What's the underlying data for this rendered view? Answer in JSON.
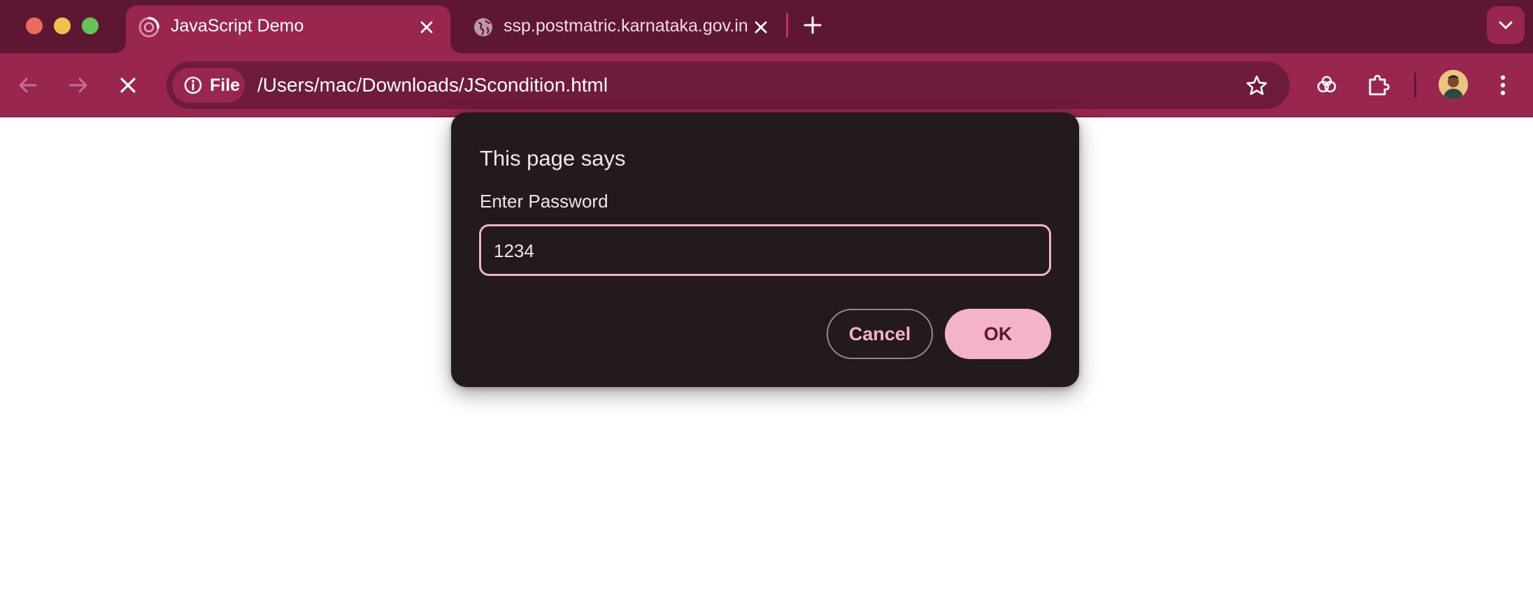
{
  "window": {
    "traffic_lights": [
      "close",
      "minimize",
      "zoom"
    ]
  },
  "tabs": [
    {
      "title": "JavaScript Demo",
      "favicon": "loading-spinner-icon",
      "active": true
    },
    {
      "title": "ssp.postmatric.karnataka.gov.in",
      "favicon": "globe-icon",
      "active": false
    }
  ],
  "toolbar": {
    "site_chip_label": "File",
    "url": "/Users/mac/Downloads/JScondition.html"
  },
  "dialog": {
    "title": "This page says",
    "message": "Enter Password",
    "input_value": "1234",
    "cancel_label": "Cancel",
    "ok_label": "OK"
  },
  "colors": {
    "tabstrip_bg": "#5e1733",
    "active_tab_bg": "#98264f",
    "omnibox_bg": "#6e1b3d",
    "dialog_bg": "#221a1d",
    "accent_pink": "#f4b3c6"
  }
}
